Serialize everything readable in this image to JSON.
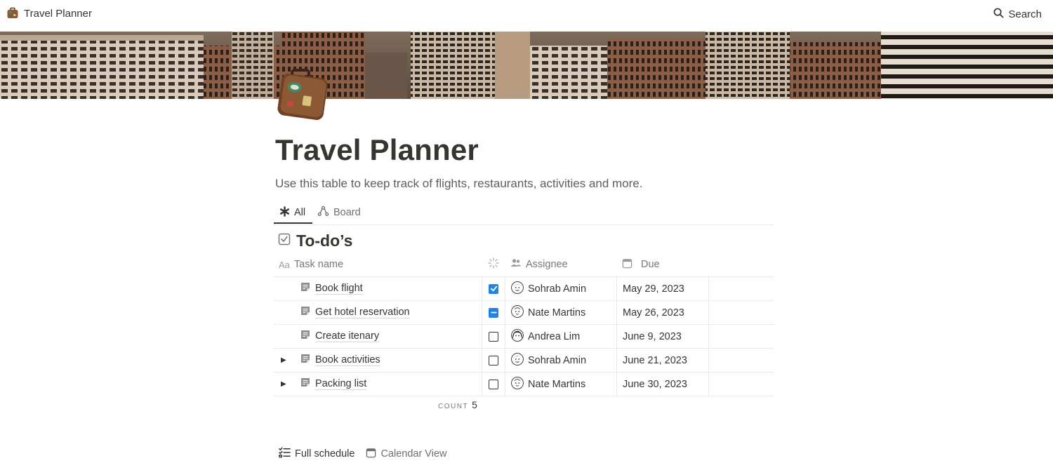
{
  "topbar": {
    "title": "Travel Planner",
    "search_label": "Search",
    "icons": [
      "suitcase-icon",
      "search-icon"
    ]
  },
  "page": {
    "title": "Travel Planner",
    "description": "Use this table to keep track of flights, restaurants, activities and more.",
    "icon": "suitcase-icon",
    "cover": "city-skyline-photo"
  },
  "views": {
    "tabs": [
      {
        "label": "All",
        "icon": "asterisk-icon",
        "active": true
      },
      {
        "label": "Board",
        "icon": "board-icon",
        "active": false
      }
    ]
  },
  "database": {
    "title": "To-do’s",
    "icon": "checkbox-icon",
    "columns": {
      "name": {
        "label": "Task name",
        "icon": "text-property-icon"
      },
      "status": {
        "label": "",
        "icon": "status-icon"
      },
      "assignee": {
        "label": "Assignee",
        "icon": "people-icon"
      },
      "due": {
        "label": "Due",
        "icon": "calendar-icon"
      }
    },
    "rows": [
      {
        "name": "Book flight",
        "status": "checked",
        "assignee": "Sohrab Amin",
        "due": "May 29, 2023",
        "expandable": false
      },
      {
        "name": "Get hotel reservation",
        "status": "partial",
        "assignee": "Nate Martins",
        "due": "May 26, 2023",
        "expandable": false
      },
      {
        "name": "Create itenary",
        "status": "unchecked",
        "assignee": "Andrea Lim",
        "due": "June 9, 2023",
        "expandable": false
      },
      {
        "name": "Book activities",
        "status": "unchecked",
        "assignee": "Sohrab Amin",
        "due": "June 21, 2023",
        "expandable": true
      },
      {
        "name": "Packing list",
        "status": "unchecked",
        "assignee": "Nate Martins",
        "due": "June 30, 2023",
        "expandable": true
      }
    ],
    "count_label": "COUNT",
    "count_value": "5"
  },
  "bottom_views": {
    "tabs": [
      {
        "label": "Full schedule",
        "icon": "checklist-icon",
        "active": true
      },
      {
        "label": "Calendar View",
        "icon": "calendar-icon",
        "active": false
      }
    ]
  },
  "colors": {
    "accent": "#2383e2",
    "text": "#37352f",
    "muted": "#787774",
    "divider": "#e9e9e7"
  }
}
